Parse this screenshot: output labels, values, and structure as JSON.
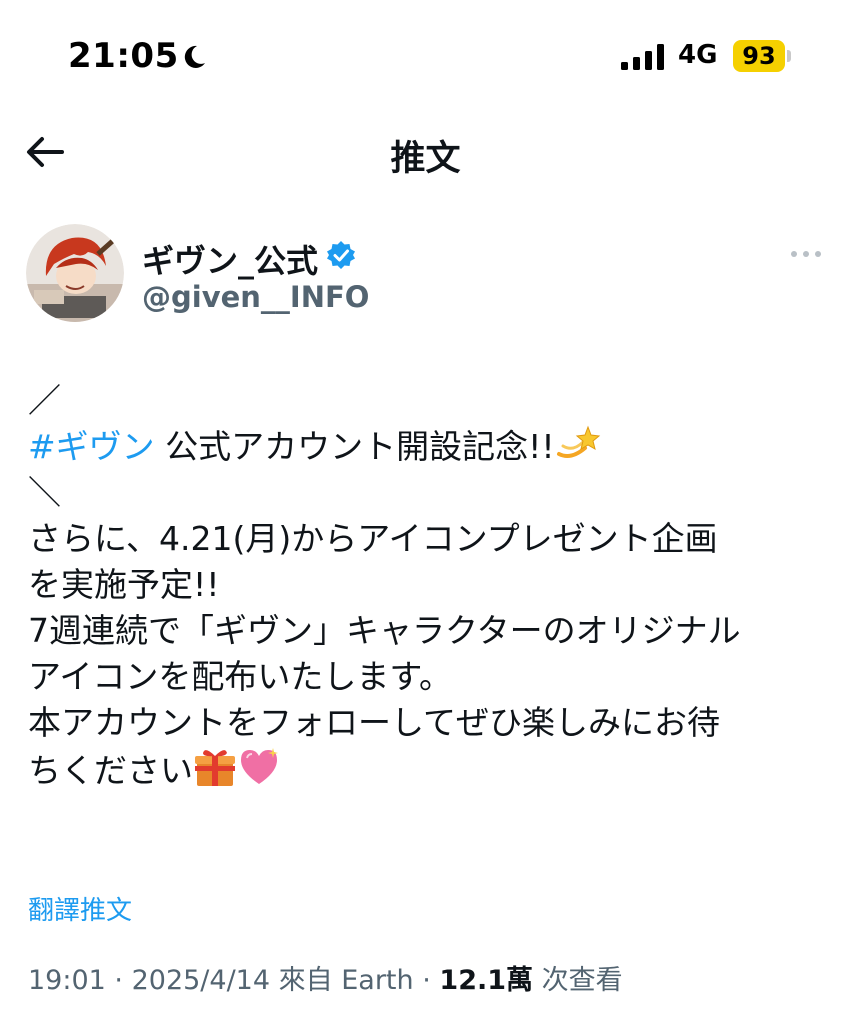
{
  "status_bar": {
    "time": "21:05",
    "network": "4G",
    "battery": "93",
    "battery_color": "#f5d000"
  },
  "header": {
    "title": "推文",
    "back_icon": "arrow-left-icon"
  },
  "author": {
    "name": "ギヴン_公式",
    "handle": "@given__INFO",
    "verified_color": "#1d9bf0"
  },
  "tweet": {
    "lines": [
      "／",
      "公式アカウント開設記念",
      "＼",
      "さらに、4.21(月)からアイコンプレゼント企画",
      "を実施予定",
      "7週連続で「ギヴン」キャラクターのオリジナル",
      "アイコンを配布いたします。",
      "本アカウントをフォローしてぜひ楽しみにお待",
      "ちください"
    ],
    "hashtag": "#ギヴン",
    "exclaim": "!!",
    "emojis": [
      "dizzy-star-icon",
      "gift-icon",
      "sparkling-heart-icon"
    ]
  },
  "translate_label": "翻譯推文",
  "meta": {
    "time": "19:01",
    "separator": "·",
    "date": "2025/4/14",
    "source": "來自 Earth",
    "views_count": "12.1萬",
    "views_label": "次查看"
  },
  "colors": {
    "accent": "#1d9bf0",
    "text": "#0f1419",
    "secondary": "#536471"
  }
}
